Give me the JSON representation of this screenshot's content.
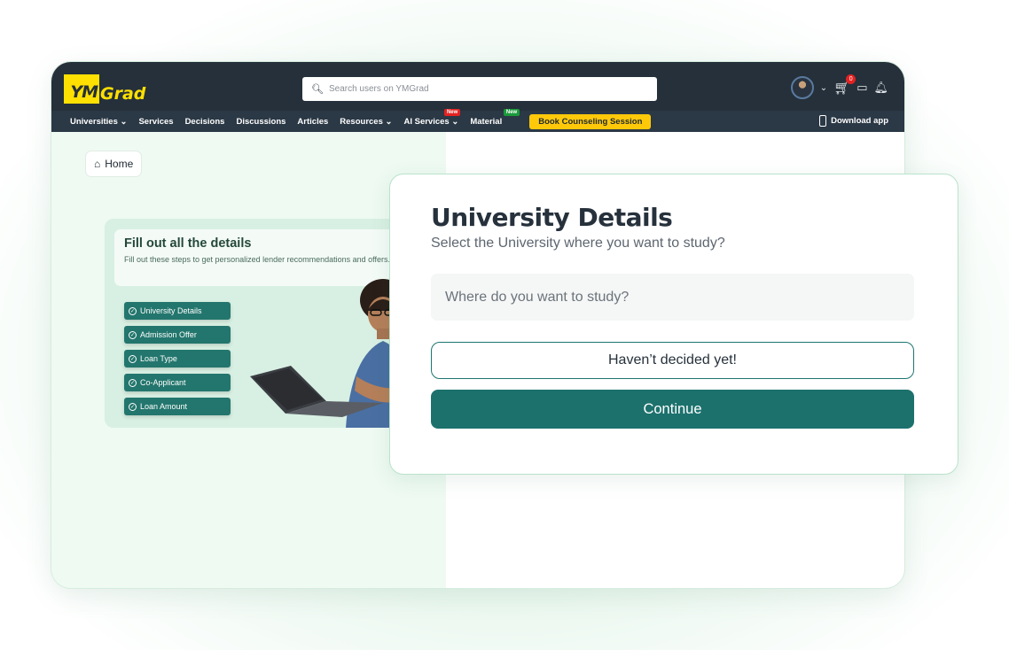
{
  "header": {
    "logo_box": "YM",
    "logo_rest": "Grad",
    "search_placeholder": "Search users on YMGrad",
    "cart_count": "0"
  },
  "nav": {
    "items": [
      {
        "label": "Universities ⌄"
      },
      {
        "label": "Services"
      },
      {
        "label": "Decisions"
      },
      {
        "label": "Discussions"
      },
      {
        "label": "Articles"
      },
      {
        "label": "Resources ⌄"
      },
      {
        "label": "AI Services ⌄",
        "tag": "New"
      },
      {
        "label": "Material",
        "tag": "New"
      }
    ],
    "cta": "Book Counseling Session",
    "download": "Download app"
  },
  "colors": {
    "tag_red": "#e32222",
    "tag_green": "#1a9a3a",
    "accent": "#1c716d",
    "logo_yellow": "#ffe000"
  },
  "breadcrumb": {
    "home": "Home"
  },
  "promo": {
    "title": "Fill out all the details",
    "subtitle": "Fill out these steps to get personalized lender recommendations and offers.",
    "steps": [
      "University Details",
      "Admission Offer",
      "Loan Type",
      "Co-Applicant",
      "Loan Amount"
    ]
  },
  "modal": {
    "title": "University Details",
    "subtitle": "Select the University where you want to study?",
    "input_placeholder": "Where do you want to study?",
    "undecided_label": "Haven’t decided yet!",
    "continue_label": "Continue"
  }
}
